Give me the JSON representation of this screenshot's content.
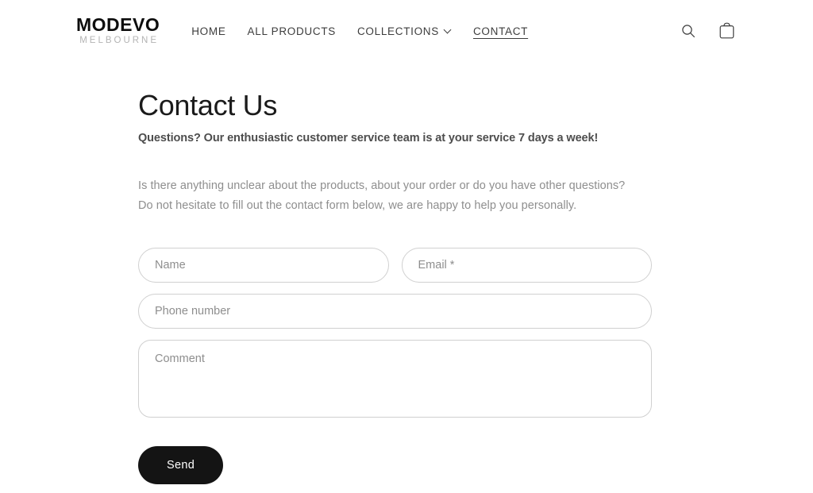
{
  "header": {
    "logo": {
      "main": "MODEVO",
      "sub": "MELBOURNE"
    },
    "nav": [
      {
        "label": "HOME",
        "active": false,
        "has_chevron": false
      },
      {
        "label": "ALL PRODUCTS",
        "active": false,
        "has_chevron": false
      },
      {
        "label": "COLLECTIONS",
        "active": false,
        "has_chevron": true
      },
      {
        "label": "CONTACT",
        "active": true,
        "has_chevron": false
      }
    ],
    "actions": {
      "search_icon": "search-icon",
      "cart_icon": "shopping-bag-icon"
    }
  },
  "main": {
    "title": "Contact Us",
    "subtitle": "Questions? Our enthusiastic customer service team is at your service 7 days a week!",
    "intro": "Is there anything unclear about the products, about your order or do you have other questions? Do not hesitate to fill out the contact form below, we are happy to help you personally.",
    "form": {
      "name": {
        "placeholder": "Name",
        "value": ""
      },
      "email": {
        "placeholder": "Email *",
        "value": ""
      },
      "phone": {
        "placeholder": "Phone number",
        "value": ""
      },
      "comment": {
        "placeholder": "Comment",
        "value": ""
      },
      "submit_label": "Send"
    }
  },
  "colors": {
    "background": "#ffffff",
    "text_primary": "#1a1a1a",
    "text_muted": "#8e8e8e",
    "border": "#d0d0d0",
    "button_bg": "#141414",
    "logo_sub": "#b4b4b4"
  }
}
